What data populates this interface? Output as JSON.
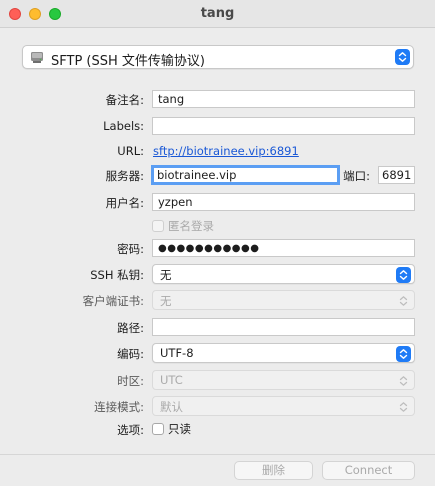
{
  "window": {
    "title": "tang"
  },
  "protocol": {
    "label": "SFTP (SSH 文件传输协议)",
    "icon": "network-drive-icon"
  },
  "form": {
    "nickname_label": "备注名:",
    "nickname_value": "tang",
    "labels_label": "Labels:",
    "labels_value": "",
    "url_label": "URL:",
    "url_value": "sftp://biotrainee.vip:6891",
    "server_label": "服务器:",
    "server_value": "biotrainee.vip",
    "port_label": "端口:",
    "port_value": "6891",
    "username_label": "用户名:",
    "username_value": "yzpen",
    "anonymous_label": "匿名登录",
    "password_label": "密码:",
    "password_value": "●●●●●●●●●●●",
    "ssh_key_label": "SSH 私钥:",
    "ssh_key_value": "无",
    "client_cert_label": "客户端证书:",
    "client_cert_value": "无",
    "path_label": "路径:",
    "path_value": "",
    "encoding_label": "编码:",
    "encoding_value": "UTF-8",
    "timezone_label": "时区:",
    "timezone_value": "UTC",
    "connect_mode_label": "连接模式:",
    "connect_mode_value": "默认",
    "options_label": "选项:",
    "readonly_label": "只读"
  },
  "buttons": {
    "delete": "删除",
    "connect": "Connect"
  },
  "colors": {
    "accent": "#1f7bf6",
    "link": "#1a58d6",
    "focus_ring": "#5b9ef3"
  }
}
